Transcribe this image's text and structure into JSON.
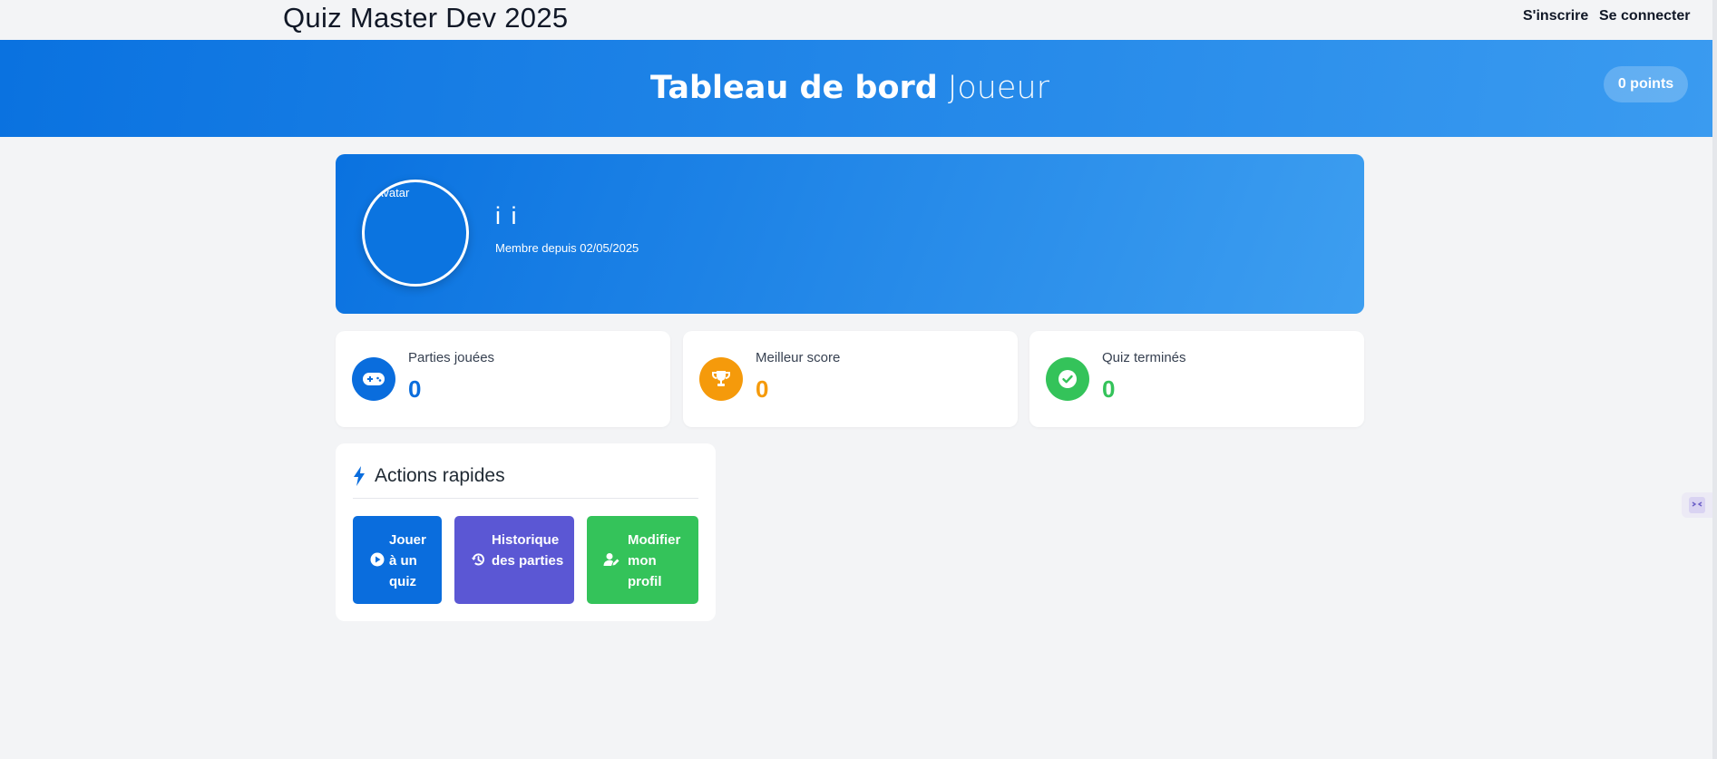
{
  "app": {
    "brand": "Quiz Master Dev 2025"
  },
  "nav": {
    "signup_label": "S'inscrire",
    "login_label": "Se connecter"
  },
  "hero": {
    "title_strong": "Tableau de bord",
    "title_light": "Joueur",
    "points": "0 points"
  },
  "profile": {
    "avatar_alt": "Avatar",
    "username": "i i",
    "member_since": "Membre depuis 02/05/2025"
  },
  "stats": [
    {
      "label": "Parties jouées",
      "value": "0",
      "icon": "gamepad-icon",
      "color": "#0a6ddd"
    },
    {
      "label": "Meilleur score",
      "value": "0",
      "icon": "trophy-icon",
      "color": "#f59a0b"
    },
    {
      "label": "Quiz terminés",
      "value": "0",
      "icon": "check-circle-icon",
      "color": "#34c35a"
    }
  ],
  "actions": {
    "title": "Actions rapides",
    "title_icon": "bolt-icon",
    "buttons": [
      {
        "label": "Jouer à un quiz",
        "icon": "play-circle-icon",
        "color": "#0a6ddd"
      },
      {
        "label": "Historique des parties",
        "icon": "history-icon",
        "color": "#5b57d4"
      },
      {
        "label": "Modifier mon profil",
        "icon": "user-edit-icon",
        "color": "#34c35a"
      }
    ]
  },
  "colors": {
    "primary": "#0a72e0",
    "primary_light": "#3d9ef0",
    "background": "#f3f4f6"
  }
}
